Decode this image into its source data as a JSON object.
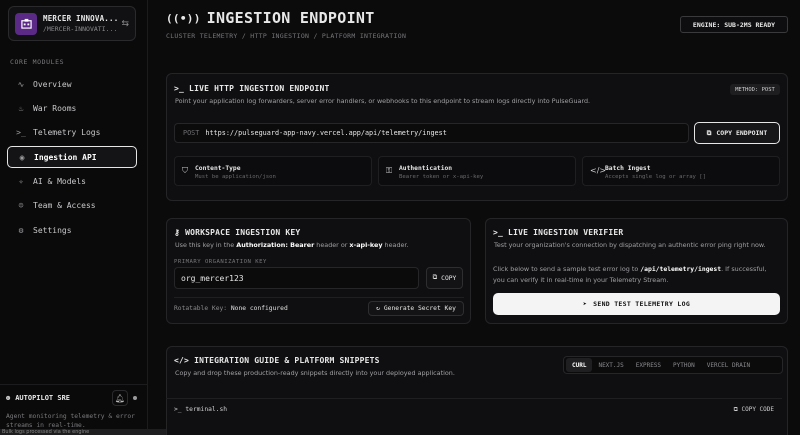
{
  "sidebar": {
    "org_name": "MERCER INNOVA...",
    "org_sub": "/MERCER-INNOVATI...",
    "section_label": "CORE MODULES",
    "items": [
      {
        "label": "Overview",
        "icon": "activity-icon"
      },
      {
        "label": "War Rooms",
        "icon": "flame-icon"
      },
      {
        "label": "Telemetry Logs",
        "icon": "terminal-icon"
      },
      {
        "label": "Ingestion API",
        "icon": "broadcast-icon",
        "active": true
      },
      {
        "label": "AI & Models",
        "icon": "sparkles-icon"
      },
      {
        "label": "Team & Access",
        "icon": "users-icon"
      },
      {
        "label": "Settings",
        "icon": "gear-icon"
      }
    ],
    "autopilot_title": "AUTOPILOT SRE",
    "autopilot_desc": "Agent monitoring telemetry & error streams in real-time.",
    "toast": "Bulk logs processed via the engine"
  },
  "header": {
    "title": "INGESTION ENDPOINT",
    "breadcrumb": "CLUSTER TELEMETRY / HTTP INGESTION / PLATFORM INTEGRATION",
    "engine_badge": "ENGINE: SUB-2MS READY"
  },
  "endpoint": {
    "title": "LIVE HTTP INGESTION ENDPOINT",
    "desc": "Point your application log forwarders, server error handlers, or webhooks to this endpoint to stream logs directly into PulseGuard.",
    "method_badge": "METHOD: POST",
    "verb": "POST",
    "url": "https://pulseguard-app-navy.vercel.app/api/telemetry/ingest",
    "copy_label": "COPY ENDPOINT",
    "features": [
      {
        "title": "Content-Type",
        "desc": "Must be application/json",
        "icon": "shield-icon"
      },
      {
        "title": "Authentication",
        "desc": "Bearer token or x-api-key",
        "icon": "key-icon"
      },
      {
        "title": "Batch Ingest",
        "desc": "Accepts single log or array []",
        "icon": "code-icon"
      }
    ]
  },
  "workspace_key": {
    "title": "WORKSPACE INGESTION KEY",
    "desc_prefix": "Use this key in the ",
    "desc_header": "Authorization: Bearer",
    "desc_mid": " header or ",
    "desc_key": "x-api-key",
    "desc_suffix": " header.",
    "field_label": "PRIMARY ORGANIZATION KEY",
    "value": "org_mercer123",
    "copy_label": "COPY",
    "rotatable_label": "Rotatable Key:",
    "rotatable_value": "None configured",
    "generate_label": "Generate Secret Key"
  },
  "verifier": {
    "title": "LIVE INGESTION VERIFIER",
    "desc": "Test your organization's connection by dispatching an authentic error ping right now.",
    "body_prefix": "Click below to send a sample test error log to ",
    "body_path": "/api/telemetry/ingest",
    "body_suffix": ". If successful, you can verify it in real-time in your Telemetry Stream.",
    "button_label": "SEND TEST TELEMETRY LOG"
  },
  "guide": {
    "title": "INTEGRATION GUIDE & PLATFORM SNIPPETS",
    "desc": "Copy and drop these production-ready snippets directly into your deployed application.",
    "tabs": [
      "CURL",
      "NEXT.JS",
      "EXPRESS",
      "PYTHON",
      "VERCEL DRAIN"
    ],
    "terminal_name": "terminal.sh",
    "copy_code": "COPY CODE"
  }
}
